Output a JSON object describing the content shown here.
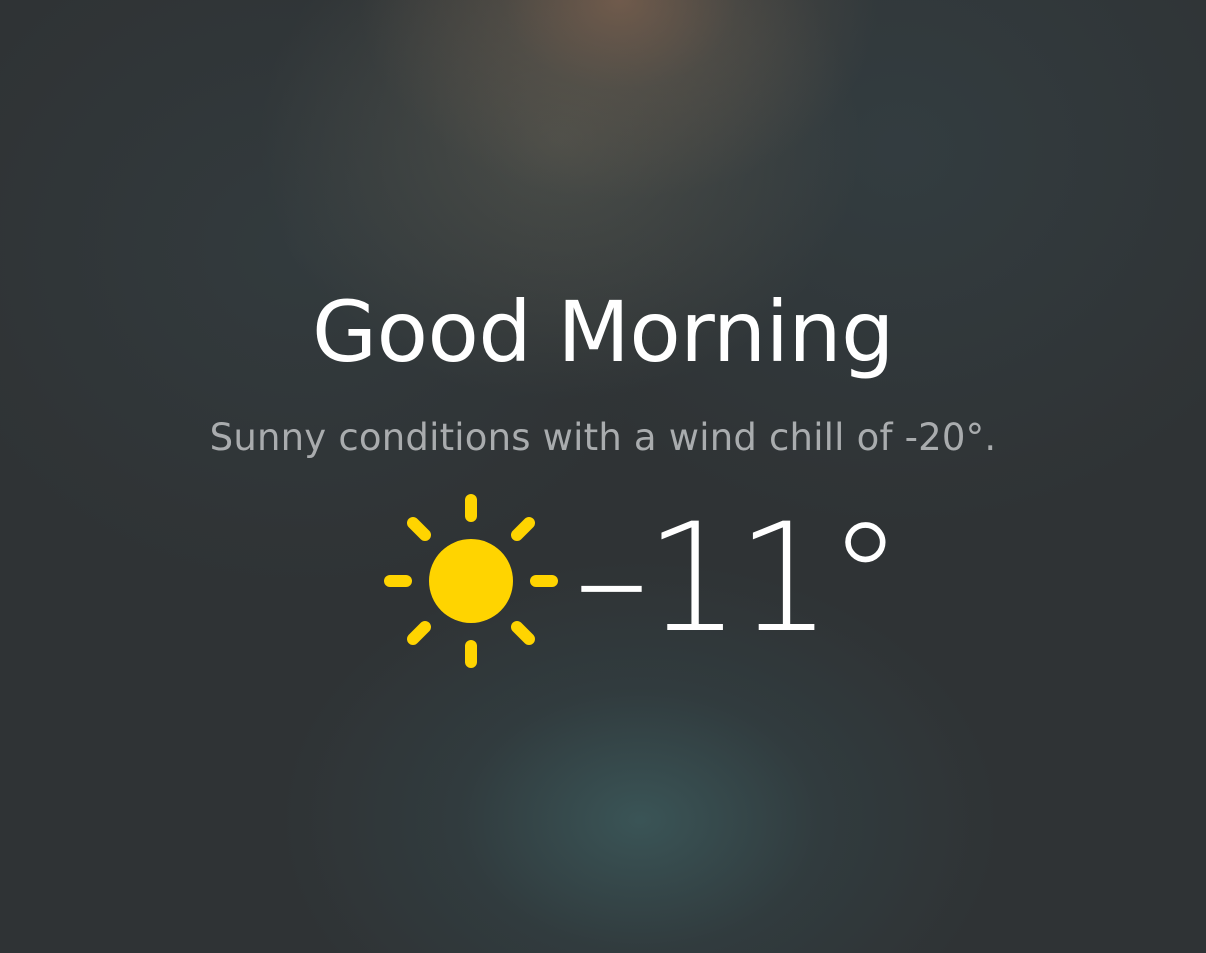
{
  "greeting": {
    "title": "Good Morning",
    "subtitle": "Sunny conditions with a wind chill of -20°."
  },
  "weather": {
    "icon": "sun-icon",
    "icon_color": "#FFD400",
    "temperature": "–11°"
  },
  "colors": {
    "title_text": "#FFFFFF",
    "subtitle_text": "#A9ACAE",
    "background": "#2F3335"
  }
}
